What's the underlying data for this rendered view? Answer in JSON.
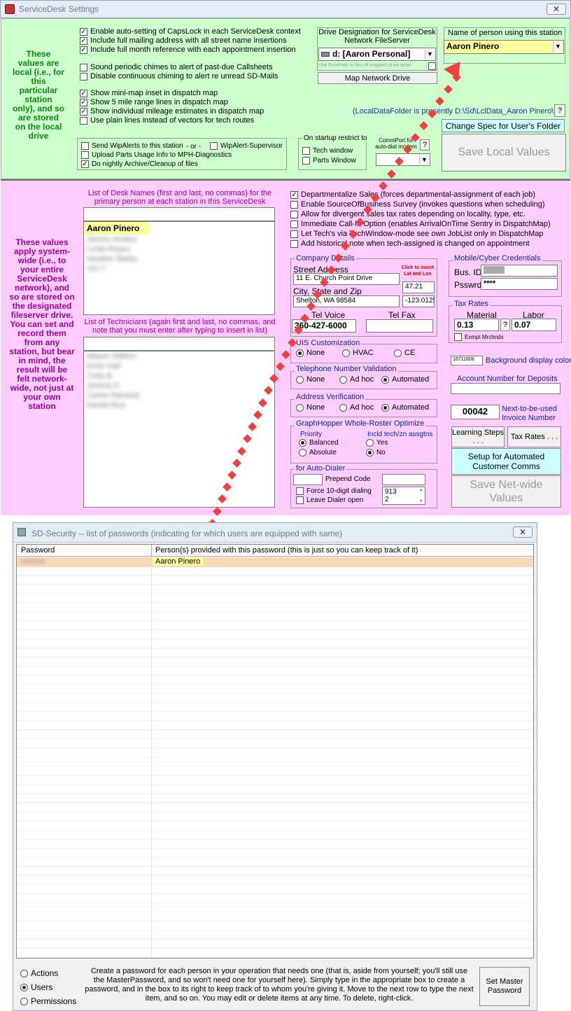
{
  "settings_window": {
    "title": "ServiceDesk Settings",
    "close": "✕",
    "local": {
      "note": "These values are local (i.e., for this particular station only), and so are stored on the local drive",
      "checks": [
        {
          "label": "Enable auto-setting of CapsLock in each ServiceDesk context",
          "checked": true
        },
        {
          "label": "Include full mailing address with all street name insertions",
          "checked": true
        },
        {
          "label": "Include full month reference with each appointment insertion",
          "checked": true
        },
        {
          "label": "Sound periodic chimes to alert of past-due Callsheets",
          "checked": false
        },
        {
          "label": "Disable continuous chiming to alert re unread SD-Mails",
          "checked": false
        },
        {
          "label": "Show mini-map inset in dispatch map",
          "checked": true
        },
        {
          "label": "Show 5 mile range lines in dispatch map",
          "checked": true
        },
        {
          "label": "Show individual mileage estimates in dispatch map",
          "checked": true
        },
        {
          "label": "Use plain lines instead of vectors for tech routes",
          "checked": false
        }
      ],
      "small_checks": [
        {
          "label": "Send WipAlerts to this station",
          "checked": false
        },
        {
          "label": "- or -",
          "checked": null
        },
        {
          "label": "WipAlert-Supervisor",
          "checked": false
        },
        {
          "label": "Upload Parts Usage Info to MPH-Diagnostics",
          "checked": false
        },
        {
          "label": "Do nightly Archive/Cleanup of files",
          "checked": true
        }
      ],
      "startup": {
        "label": "On startup restrict to",
        "options": [
          "Tech window",
          "Parts Window"
        ]
      },
      "commport": {
        "label": "CommPort for auto-dial modem",
        "help": "?"
      },
      "drive": {
        "label": "Drive Designation for ServiceDesk Network FileServer",
        "value": "d: [Aaron Personal]",
        "rowpath": "Use RowPath in lieu of mapped drive letter",
        "map_button": "Map Network Drive"
      },
      "name_person": {
        "label": "Name of  person using this station",
        "value": "Aaron Pinero"
      },
      "local_folder": "(LocalDataFolder is presently D:\\Sd\\LclData_Aaron Pinero\\)",
      "help": "?",
      "change_spec": "Change Spec for User's Folder",
      "save_local": "Save Local Values"
    },
    "network": {
      "note": "These values apply system-wide (i.e., to your entire ServiceDesk network), and so are stored on the designated fileserver drive.  You can set and record them from any station, but bear in mind, the result will be felt network-wide, not just at your own station",
      "desk_names_label": "List of Desk Names (first and last, no commas) for the primary person at each station in this ServiceDesk",
      "desk_names": [
        "Aaron Pinero",
        "Steven Anders",
        "Linda Reyes",
        "Heather Marks",
        "Jim T"
      ],
      "tech_label": "List of Technicians (again first and last, no commas, and note that you must enter after typing to insert in list)",
      "techs": [
        "Mason Wilkins",
        "Drew Hall",
        "Cody B",
        "Jeremy K",
        "Carlos Ramirez",
        "Daniel Rice"
      ],
      "checks": [
        {
          "label": "Departmentalize Sales (forces departmental-assignment of each job)",
          "checked": true
        },
        {
          "label": "Enable SourceOfBusiness Survey (invokes questions when scheduling)",
          "checked": false
        },
        {
          "label": "Allow for divergent sales tax rates depending on locality, type, etc.",
          "checked": false
        },
        {
          "label": "Immediate Call-In Option (enables ArrivalOnTime Sentry in DispatchMap)",
          "checked": false
        },
        {
          "label": "Let Tech's via TechWindow-mode see own JobList only in DispatchMap",
          "checked": false
        },
        {
          "label": "Add historical note when tech-assigned is changed on appointment",
          "checked": false
        }
      ],
      "company": {
        "label": "Company Details",
        "street_label": "Street Address",
        "street": "11 E. Church Point Drive",
        "click_insert": "Click to insert Lat and Lon",
        "lat": "47.21",
        "city_label": "City, State and Zip",
        "city": "Shelton, WA 98584",
        "lon": "-123.0125",
        "tel_voice_label": "Tel Voice",
        "tel_voice": "360-427-6000",
        "tel_fax_label": "Tel Fax",
        "tel_fax": ""
      },
      "uis": {
        "label": "UIS Customization",
        "options": [
          "None",
          "HVAC",
          "CE"
        ],
        "selected": 0
      },
      "phone": {
        "label": "Telephone Number Validation",
        "options": [
          "None",
          "Ad hoc",
          "Automated"
        ],
        "selected": 2
      },
      "address": {
        "label": "Address Verification",
        "options": [
          "None",
          "Ad hoc",
          "Automated"
        ],
        "selected": 2
      },
      "graphhopper": {
        "label": "GraphHopper Whole-Roster Optimize",
        "priority_label": "Priority",
        "priority": [
          "Balanced",
          "Absolute"
        ],
        "priority_sel": 0,
        "incl_label": "Incld tech/zn assgtns",
        "incl": [
          "Yes",
          "No"
        ],
        "incl_sel": 1
      },
      "dialer": {
        "label": "for Auto-Dialer",
        "prepend": "Prepend Code",
        "force": "Force 10-digit dialing",
        "leave": "Leave Dialer open",
        "spin1": "913",
        "spin2": "2"
      },
      "mobile": {
        "label": "Mobile/Cyber Credentials",
        "bus_id": "Bus. ID",
        "psswrd": "Psswrd",
        "psswrd_value": "****"
      },
      "tax": {
        "label": "Tax Rates",
        "material": "Material",
        "labor": "Labor",
        "material_value": "0.13",
        "labor_value": "0.07",
        "help": "?",
        "exempt": "Exmpt Mrchnds"
      },
      "bg_color_value": "16711808",
      "bg_color_label": "Background display color",
      "deposit_label": "Account Number for Deposits",
      "invoice_value": "00042",
      "invoice_label": "Next-to-be-used Invoice Number",
      "learning": "Learning Steps . . .",
      "taxrates_btn": "Tax Rates . . .",
      "setup_comms": "Setup for Automated Customer Comms",
      "save_net": "Save Net-wide Values"
    }
  },
  "security_window": {
    "title": "SD-Security -- list of passwords (indicating for which users are equipped with same)",
    "close": "✕",
    "col_password": "Password",
    "col_persons": "Person(s) provided with this password (this is just so you can keep track of it)",
    "rows": [
      {
        "password": "•••••••••",
        "person": "Aaron Pinero"
      }
    ],
    "modes": [
      "Actions",
      "Users",
      "Permissions"
    ],
    "mode_selected": 1,
    "instructions": "Create a password for each person in your operation that needs one (that is, aside from yourself; you'll still use the MasterPassword, and so won't need one for yourself here).  Simply type in the appropriate box to create a password, and in the box to its right to keep track of to whom you're giving it.  Move to the next row to type the next item, and so on.  You may edit or delete items at any time.  To delete, right-click.",
    "set_master": "Set Master Password"
  },
  "colors": {
    "local_bg": "#ccffcc",
    "network_bg": "#ffccff",
    "highlight": "#ffff9c",
    "arrow": "#f04040",
    "cyan_btn": "#ccffff"
  }
}
